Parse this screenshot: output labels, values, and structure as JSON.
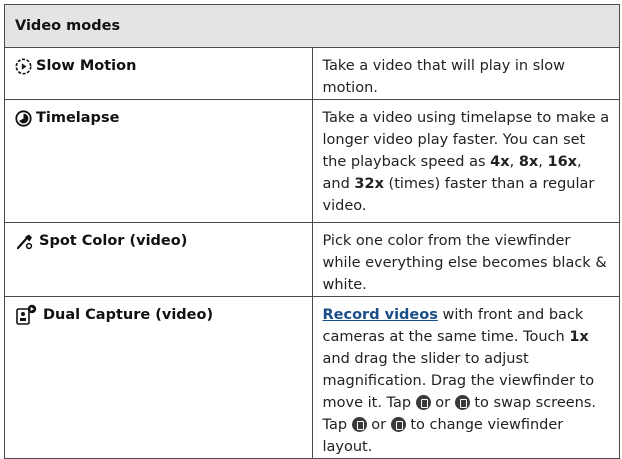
{
  "table": {
    "header": "Video modes",
    "rows": [
      {
        "icon": "slow-motion-icon",
        "mode": "Slow Motion",
        "description": "Take a video that will play in slow motion."
      },
      {
        "icon": "timelapse-icon",
        "mode": "Timelapse",
        "description_parts": {
          "before": "Take a video using timelapse to make a longer video play faster. You can set the playback speed as ",
          "opt1": "4x",
          "sep1": ", ",
          "opt2": "8x",
          "sep2": ", ",
          "opt3": "16x",
          "sep3": ", and ",
          "opt4": "32x",
          "after": " (times) faster than a regular video."
        }
      },
      {
        "icon": "spot-color-icon",
        "mode": "Spot Color (video)",
        "description": "Pick one color from the viewfinder while everything else becomes black & white."
      },
      {
        "icon": "dual-capture-icon",
        "mode": "Dual Capture (video)",
        "description_parts": {
          "link": "Record videos",
          "text1": " with front and back cameras at the same time. Touch ",
          "bold1": "1x",
          "text2": " and drag the slider to adjust magnification. Drag the viewfinder to move it. Tap ",
          "text3": " or ",
          "text4": " to swap screens. Tap ",
          "text5": " or ",
          "text6": " to change viewfinder layout."
        },
        "inline_icons": [
          "swap-screens-icon",
          "swap-screens-alt-icon",
          "layout-icon",
          "layout-alt-icon"
        ]
      }
    ]
  }
}
